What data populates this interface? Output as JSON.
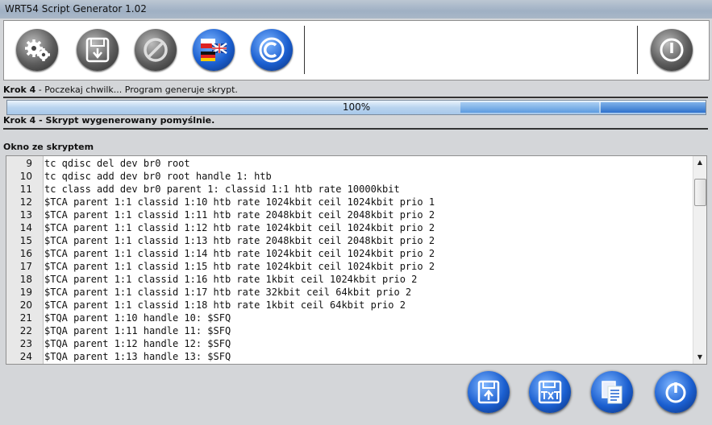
{
  "window": {
    "title": "WRT54 Script Generator 1.02"
  },
  "toolbar": {
    "buttons": [
      {
        "icon": "gears-icon"
      },
      {
        "icon": "floppy-save-icon"
      },
      {
        "icon": "forbidden-icon"
      },
      {
        "icon": "language-flags-icon"
      },
      {
        "icon": "copyright-icon"
      }
    ],
    "exit_icon": "power-icon"
  },
  "step1": {
    "label": "Krok 4",
    "text": " - Poczekaj chwilk... Program generuje skrypt."
  },
  "progress": {
    "value": 1.0,
    "label": "100%"
  },
  "step2": {
    "label": "Krok 4 - Skrypt wygenerowany pomyślnie."
  },
  "script_window": {
    "title": "Okno ze skryptem",
    "lines": [
      {
        "n": "9",
        "text": "tc qdisc del dev br0 root"
      },
      {
        "n": "10",
        "text": "tc qdisc add dev br0 root handle 1: htb"
      },
      {
        "n": "11",
        "text": "tc class add dev br0 parent 1: classid 1:1 htb rate 10000kbit"
      },
      {
        "n": "12",
        "text": "$TCA parent 1:1 classid 1:10 htb rate 1024kbit ceil 1024kbit prio 1"
      },
      {
        "n": "13",
        "text": "$TCA parent 1:1 classid 1:11 htb rate 2048kbit ceil 2048kbit prio 2"
      },
      {
        "n": "14",
        "text": "$TCA parent 1:1 classid 1:12 htb rate 1024kbit ceil 1024kbit prio 2"
      },
      {
        "n": "15",
        "text": "$TCA parent 1:1 classid 1:13 htb rate 2048kbit ceil 2048kbit prio 2"
      },
      {
        "n": "16",
        "text": "$TCA parent 1:1 classid 1:14 htb rate 1024kbit ceil 1024kbit prio 2"
      },
      {
        "n": "17",
        "text": "$TCA parent 1:1 classid 1:15 htb rate 1024kbit ceil 1024kbit prio 2"
      },
      {
        "n": "18",
        "text": "$TCA parent 1:1 classid 1:16 htb rate 1kbit ceil 1024kbit prio 2"
      },
      {
        "n": "19",
        "text": "$TCA parent 1:1 classid 1:17 htb rate 32kbit ceil 64kbit prio 2"
      },
      {
        "n": "20",
        "text": "$TCA parent 1:1 classid 1:18 htb rate 1kbit ceil 64kbit prio 2"
      },
      {
        "n": "21",
        "text": "$TQA parent 1:10 handle 10: $SFQ"
      },
      {
        "n": "22",
        "text": "$TQA parent 1:11 handle 11: $SFQ"
      },
      {
        "n": "23",
        "text": "$TQA parent 1:12 handle 12: $SFQ"
      },
      {
        "n": "24",
        "text": "$TQA parent 1:13 handle 13: $SFQ"
      }
    ]
  },
  "bottom_buttons": [
    {
      "icon": "save-upload-icon"
    },
    {
      "icon": "save-txt-icon"
    },
    {
      "icon": "copy-icon"
    },
    {
      "icon": "power-icon"
    }
  ]
}
